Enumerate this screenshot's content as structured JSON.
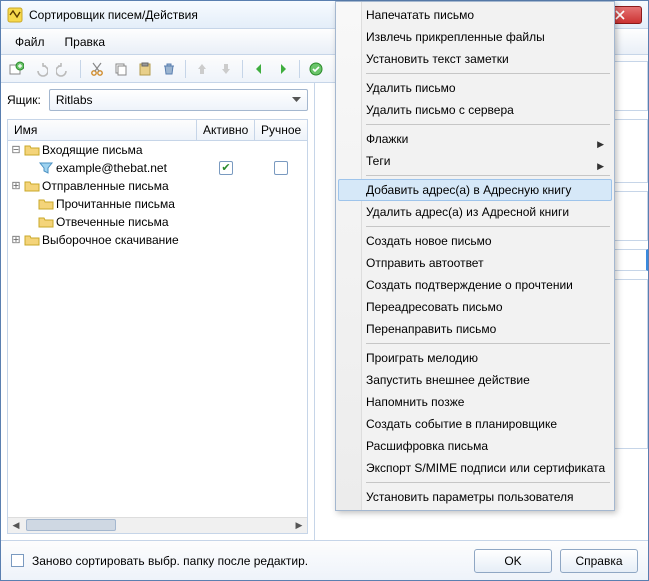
{
  "title": "Сортировщик писем/Действия",
  "menubar": {
    "file": "Файл",
    "edit": "Правка"
  },
  "box": {
    "label": "Ящик:",
    "value": "Ritlabs"
  },
  "columns": {
    "name": "Имя",
    "active": "Активно",
    "manual": "Ручное"
  },
  "tree": {
    "incoming": "Входящие письма",
    "example": "example@thebat.net",
    "sent": "Отправленные письма",
    "read": "Прочитанные письма",
    "answered": "Отвеченные письма",
    "selective": "Выборочное скачивание"
  },
  "footer": {
    "resort": "Заново сортировать выбр. папку после редактир.",
    "ok": "OK",
    "help": "Справка"
  },
  "menu": {
    "print": "Напечатать письмо",
    "extract": "Извлечь прикрепленные файлы",
    "setnote": "Установить текст заметки",
    "delete": "Удалить письмо",
    "delete_server": "Удалить письмо с сервера",
    "flags": "Флажки",
    "tags": "Теги",
    "add_addr": "Добавить адрес(а) в Адресную книгу",
    "del_addr": "Удалить адрес(а) из Адресной книги",
    "new_msg": "Создать новое письмо",
    "autoreply": "Отправить автоответ",
    "confirm": "Создать подтверждение о прочтении",
    "readdress": "Переадресовать письмо",
    "redirect": "Перенаправить письмо",
    "play": "Проиграть мелодию",
    "extern": "Запустить внешнее действие",
    "remind": "Напомнить позже",
    "schedule": "Создать событие в планировщике",
    "decrypt": "Расшифровка письма",
    "smime": "Экспорт S/MIME подписи или сертификата",
    "userparams": "Установить параметры пользователя"
  }
}
